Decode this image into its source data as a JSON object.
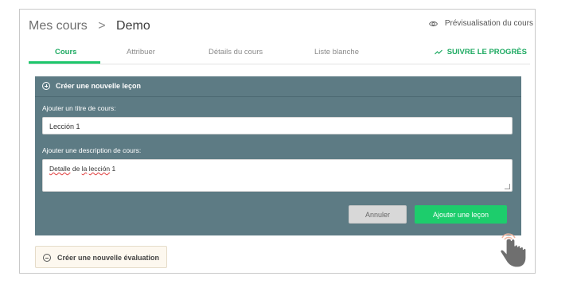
{
  "breadcrumb": {
    "parent": "Mes cours",
    "separator": ">",
    "current": "Demo"
  },
  "preview": {
    "label": "Prévisualisation du cours",
    "icon": "eye-icon"
  },
  "tabs": [
    {
      "label": "Cours",
      "active": true
    },
    {
      "label": "Attribuer",
      "active": false
    },
    {
      "label": "Détails du cours",
      "active": false
    },
    {
      "label": "Liste blanche",
      "active": false
    }
  ],
  "track_progress": {
    "label": "SUIVRE LE PROGRÈS",
    "icon": "trend-icon"
  },
  "new_lesson": {
    "header": "Créer une nouvelle leçon",
    "title_label": "Ajouter un titre de cours:",
    "title_value": "Lección 1",
    "description_label": "Ajouter une description de cours:",
    "description_words": [
      "Detalle",
      "de",
      "la",
      "lección",
      "1"
    ],
    "cancel_label": "Annuler",
    "submit_label": "Ajouter une leçon"
  },
  "new_evaluation": {
    "label": "Créer une nouvelle évaluation"
  },
  "colors": {
    "accent": "#1dcd6c",
    "panel": "#5d7b84",
    "accent_text": "#1eaa62"
  }
}
